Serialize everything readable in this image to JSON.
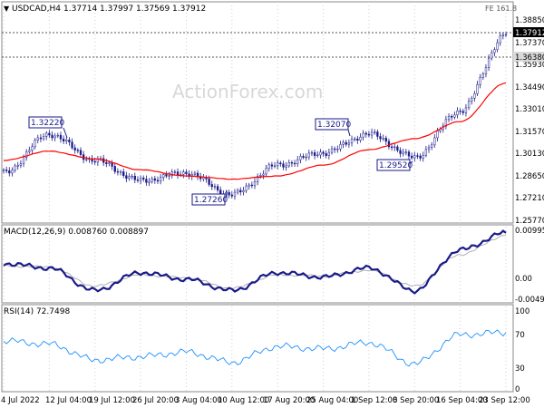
{
  "title": "USDCAD,H4",
  "ohlc": {
    "open": "1.37714",
    "high": "1.37997",
    "low": "1.37569",
    "close": "1.37912"
  },
  "fe_label": "FE 161.8",
  "watermark": "ActionForex.com",
  "colors": {
    "candle": "#1a1a8a",
    "ma": "#ff0000",
    "macd": "#1a1a8a",
    "macd_signal": "#b0b0b0",
    "rsi": "#1e90ff",
    "grid": "#cfcfcf",
    "price_box_bg": "#000000"
  },
  "price_panel": {
    "y_ticks": [
      "1.38850",
      "1.37370",
      "1.35930",
      "1.34490",
      "1.33010",
      "1.31570",
      "1.30130",
      "1.28650",
      "1.27210",
      "1.25770"
    ],
    "current_price_label": "1.37912",
    "level_label": "1.36380",
    "annotations": [
      "1.32220",
      "1.27260",
      "1.32070",
      "1.29520"
    ]
  },
  "macd_panel": {
    "label": "MACD(12,26,9) 0.008760 0.008897",
    "y_ticks": [
      "0.009956",
      "0.00",
      "-0.004912"
    ]
  },
  "rsi_panel": {
    "label": "RSI(14) 72.7498",
    "y_ticks": [
      "100",
      "70",
      "30",
      "0"
    ]
  },
  "x_ticks": [
    "4 Jul 2022",
    "12 Jul 04:00",
    "19 Jul 12:00",
    "26 Jul 20:00",
    "3 Aug 04:00",
    "10 Aug 12:00",
    "17 Aug 20:00",
    "25 Aug 04:00",
    "1 Sep 12:00",
    "8 Sep 20:00",
    "16 Sep 04:00",
    "23 Sep 12:00"
  ],
  "chart_data": [
    {
      "type": "candlestick",
      "title": "USDCAD,H4",
      "ylim": [
        1.2577,
        1.3885
      ],
      "x": [
        "4 Jul 2022",
        "12 Jul 04:00",
        "19 Jul 12:00",
        "26 Jul 20:00",
        "3 Aug 04:00",
        "10 Aug 12:00",
        "17 Aug 20:00",
        "25 Aug 04:00",
        "1 Sep 12:00",
        "8 Sep 20:00",
        "16 Sep 04:00",
        "23 Sep 12:00"
      ],
      "series": [
        {
          "name": "Close",
          "values": [
            1.29,
            1.315,
            1.298,
            1.285,
            1.29,
            1.276,
            1.295,
            1.303,
            1.315,
            1.3,
            1.33,
            1.3791
          ]
        },
        {
          "name": "MA",
          "values": [
            1.298,
            1.304,
            1.299,
            1.292,
            1.288,
            1.286,
            1.288,
            1.295,
            1.305,
            1.312,
            1.323,
            1.348
          ]
        }
      ],
      "annotations": [
        {
          "label": "1.32220",
          "value": 1.3222
        },
        {
          "label": "1.27260",
          "value": 1.2726
        },
        {
          "label": "1.32070",
          "value": 1.3207
        },
        {
          "label": "1.29520",
          "value": 1.2952
        }
      ],
      "horizontal_levels": [
        1.3638,
        1.3791
      ]
    },
    {
      "type": "line",
      "title": "MACD(12,26,9) 0.008760 0.008897",
      "ylim": [
        -0.004912,
        0.009956
      ],
      "series": [
        {
          "name": "MACD",
          "values": [
            0.003,
            0.002,
            -0.003,
            0.001,
            -0.0005,
            -0.003,
            0.001,
            0.0,
            0.002,
            -0.003,
            0.006,
            0.0098
          ]
        },
        {
          "name": "Signal",
          "values": [
            0.0025,
            0.0022,
            -0.002,
            0.0005,
            -0.0002,
            -0.0025,
            0.0005,
            0.0002,
            0.0015,
            -0.002,
            0.005,
            0.0092
          ]
        }
      ]
    },
    {
      "type": "line",
      "title": "RSI(14) 72.7498",
      "ylim": [
        0,
        100
      ],
      "series": [
        {
          "name": "RSI",
          "values": [
            62,
            58,
            38,
            42,
            48,
            35,
            55,
            52,
            60,
            33,
            70,
            72.7
          ]
        }
      ]
    }
  ]
}
